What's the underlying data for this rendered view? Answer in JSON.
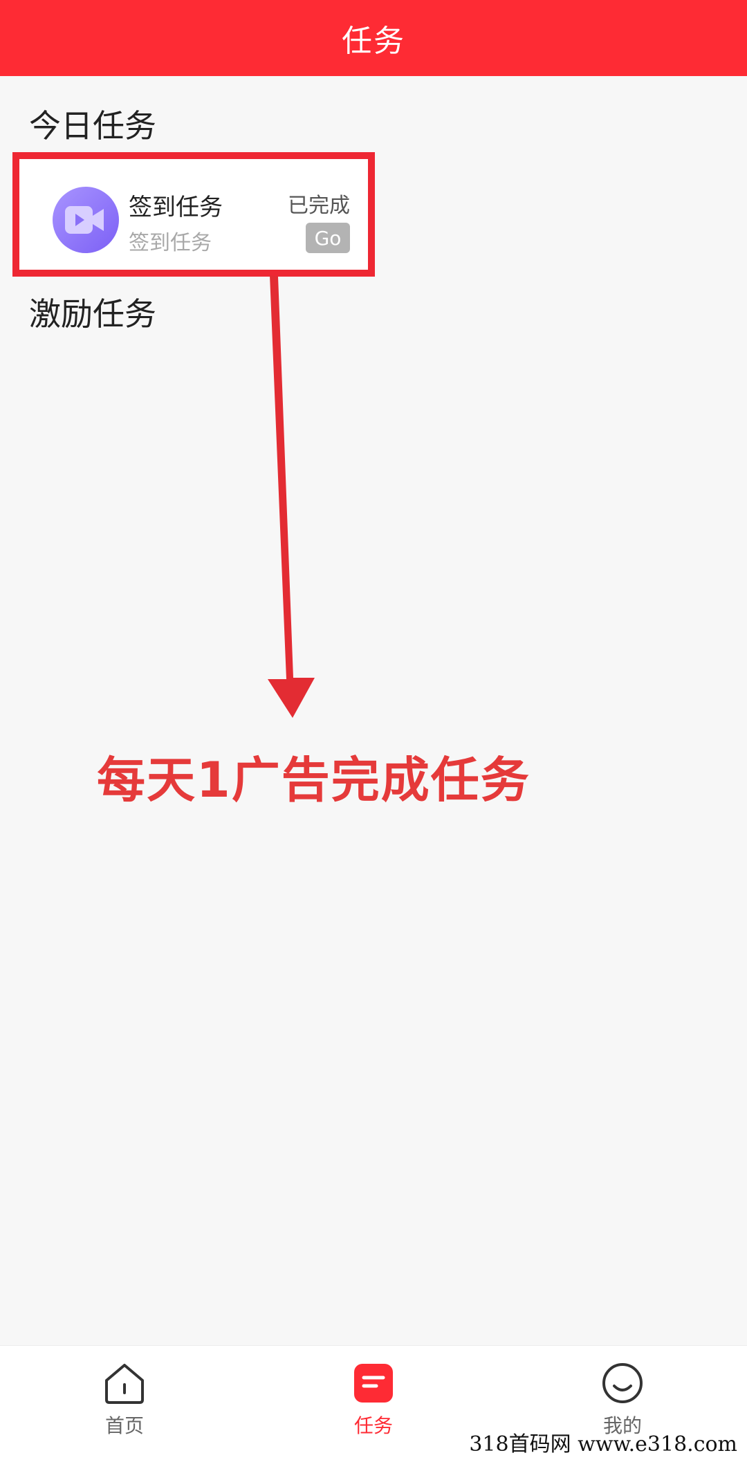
{
  "header": {
    "title": "任务"
  },
  "sections": {
    "today": "今日任务",
    "incentive": "激励任务"
  },
  "task": {
    "name": "签到任务",
    "description": "签到任务",
    "status": "已完成",
    "go_label": "Go",
    "icon": "video-camera-icon"
  },
  "annotation": {
    "text": "每天1广告完成任务",
    "color": "#e53a3a"
  },
  "tabbar": {
    "home": {
      "label": "首页",
      "icon": "home-icon"
    },
    "tasks": {
      "label": "任务",
      "icon": "task-list-icon"
    },
    "mine": {
      "label": "我的",
      "icon": "smile-icon"
    }
  },
  "watermark": "318首码网 www.e318.com",
  "colors": {
    "brand": "#fe2b34",
    "highlight_border": "#ee2733",
    "icon_purple": "#7c60f5"
  }
}
